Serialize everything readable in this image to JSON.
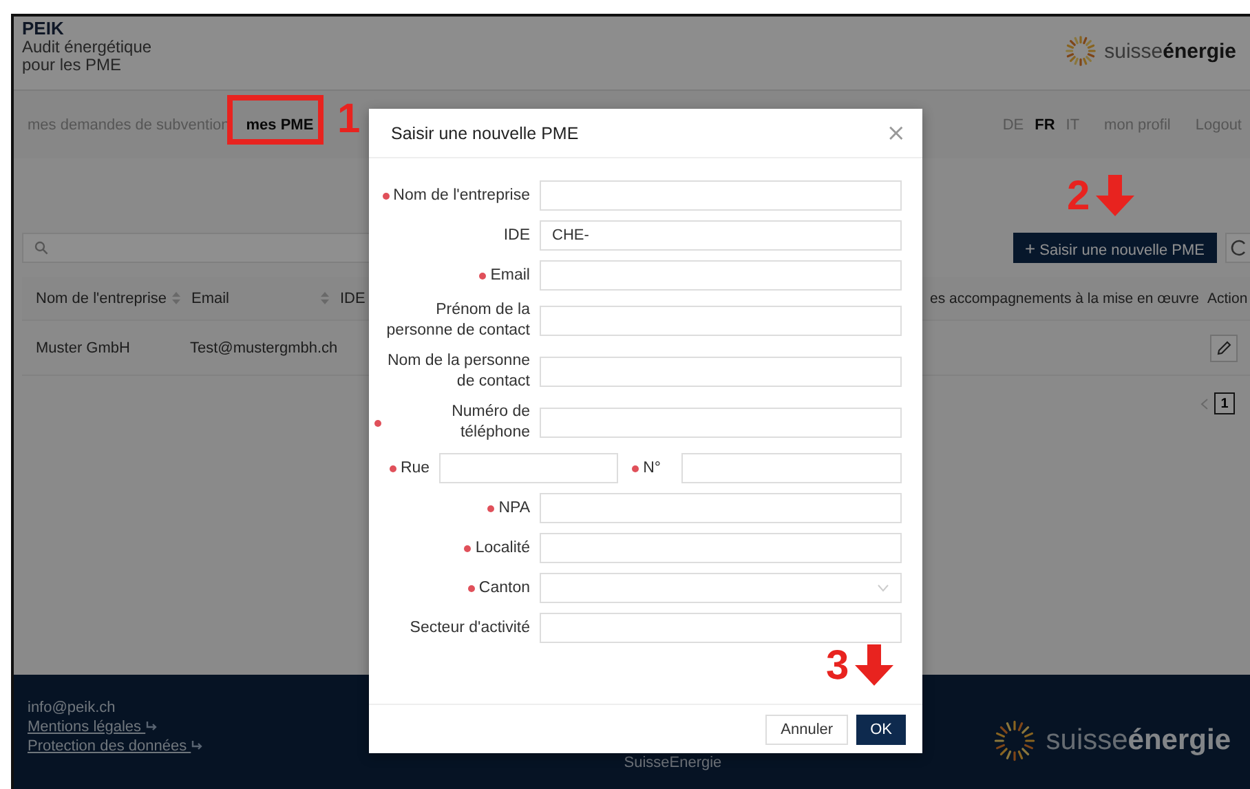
{
  "header": {
    "title": "PEIK",
    "subtitle_lines": [
      "Audit énergétique",
      "pour les PME"
    ],
    "logo_text": "suisse**énergie**"
  },
  "nav": {
    "tabs": [
      {
        "label": "mes demandes de subvention",
        "selected": false
      },
      {
        "label": "mes PME",
        "selected": true
      }
    ],
    "languages": [
      {
        "label": "DE",
        "selected": false
      },
      {
        "label": "FR",
        "selected": true
      },
      {
        "label": "IT",
        "selected": false
      }
    ],
    "links": [
      "mon profil",
      "Logout"
    ]
  },
  "toolbar": {
    "new_button": "Saisir une nouvelle PME",
    "new_button_icon": "+"
  },
  "table": {
    "left_columns": [
      "Nom de l'entreprise",
      "Email",
      "IDE"
    ],
    "right_columns": [
      "es accompagnements à la mise en œuvre",
      "Action"
    ],
    "rows": [
      {
        "company": "Muster GmbH",
        "email": "Test@mustergmbh.ch"
      }
    ]
  },
  "pagination": {
    "pages": [
      {
        "label": "1",
        "selected": true
      }
    ]
  },
  "footer": {
    "email": "info@peik.ch",
    "links": [
      "Mentions légales",
      "Protection des données"
    ],
    "center_text": "SuisseEnergie",
    "logo_text": "suisse**énergie**"
  },
  "modal": {
    "title": "Saisir une nouvelle PME",
    "close": "×",
    "fields": [
      {
        "kind": "text",
        "label": "Nom de l'entreprise",
        "required": true
      },
      {
        "kind": "text",
        "label": "IDE",
        "required": false,
        "value": "CHE-"
      },
      {
        "kind": "text",
        "label": "Email",
        "required": true
      },
      {
        "kind": "text",
        "label": "Prénom de la personne de contact",
        "required": false
      },
      {
        "kind": "text",
        "label": "Nom de la personne de contact",
        "required": false
      },
      {
        "kind": "text",
        "label": "Numéro de téléphone",
        "required": true
      },
      {
        "kind": "split",
        "label": "Rue",
        "required": true,
        "second_label": "N°",
        "second_required": true
      },
      {
        "kind": "text",
        "label": "NPA",
        "required": true
      },
      {
        "kind": "text",
        "label": "Localité",
        "required": true
      },
      {
        "kind": "select",
        "label": "Canton",
        "required": true
      },
      {
        "kind": "text",
        "label": "Secteur d'activité",
        "required": false
      }
    ],
    "buttons": [
      {
        "label": "Annuler",
        "primary": false
      },
      {
        "label": "OK",
        "primary": true
      }
    ]
  },
  "annotations": [
    {
      "number": "1",
      "kind": "box"
    },
    {
      "number": "2",
      "kind": "arrow"
    },
    {
      "number": "3",
      "kind": "arrow"
    }
  ]
}
